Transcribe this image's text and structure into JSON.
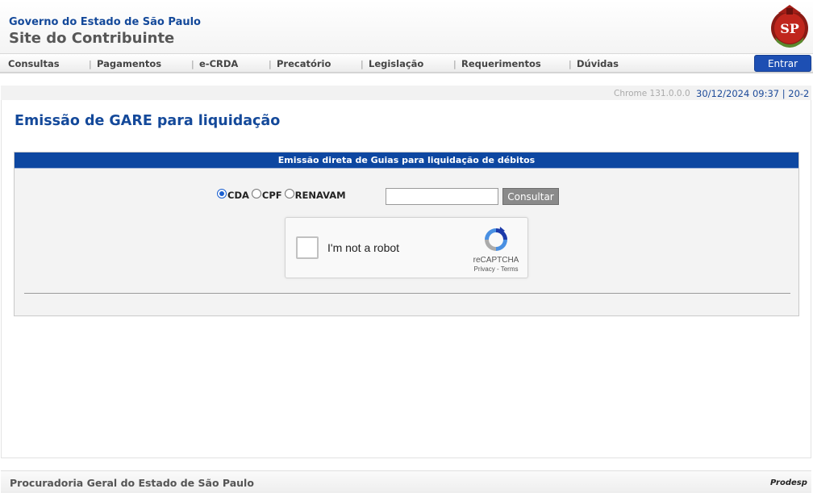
{
  "header": {
    "gov_line": "Governo do Estado de São Paulo",
    "site_title": "Site do Contribuinte",
    "emblem_icon": "sp-coat-of-arms-icon",
    "emblem_text": "SP"
  },
  "nav": {
    "items": [
      {
        "label": "Consultas"
      },
      {
        "label": "Pagamentos"
      },
      {
        "label": "e-CRDA"
      },
      {
        "label": "Precatório"
      },
      {
        "label": "Legislação"
      },
      {
        "label": "Requerimentos"
      },
      {
        "label": "Dúvidas"
      }
    ],
    "separator": "|",
    "login_label": "Entrar",
    "login_color": "#1d4fb3"
  },
  "info_bar": {
    "browser": "Chrome 131.0.0.0",
    "datetime": "30/12/2024 09:37 | 20-2"
  },
  "main": {
    "title": "Emissão de GARE para liquidação",
    "panel_header": "Emissão direta de Guias para liquidação de débitos",
    "panel_header_color": "#0d47a1",
    "radio_options": [
      {
        "label": "CDA",
        "checked": true
      },
      {
        "label": "CPF",
        "checked": false
      },
      {
        "label": "RENAVAM",
        "checked": false
      }
    ],
    "input_value": "",
    "consultar_label": "Consultar"
  },
  "captcha": {
    "label": "I'm not a robot",
    "brand": "reCAPTCHA",
    "privacy": "Privacy",
    "links_sep": "-",
    "terms": "Terms",
    "icon": "recaptcha-logo-icon"
  },
  "footer": {
    "text": "Procuradoria Geral do Estado de São Paulo",
    "brand": "Prodesp",
    "brand_icon": "prodesp-logo-icon"
  }
}
